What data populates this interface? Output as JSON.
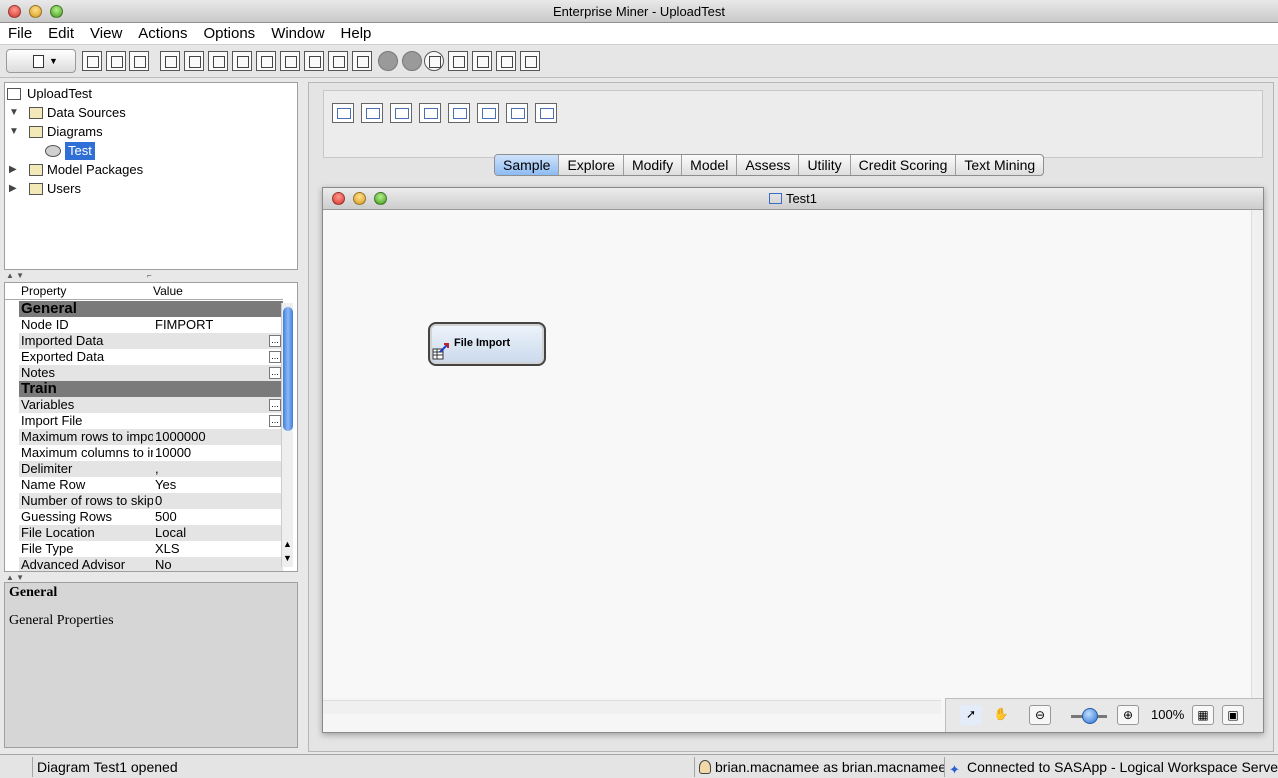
{
  "window": {
    "title": "Enterprise Miner - UploadTest"
  },
  "menu": [
    "File",
    "Edit",
    "View",
    "Actions",
    "Options",
    "Window",
    "Help"
  ],
  "tree": {
    "project": "UploadTest",
    "items": [
      {
        "label": "Data Sources",
        "expanded": true
      },
      {
        "label": "Diagrams",
        "expanded": true
      },
      {
        "label": "Test",
        "selected": true
      },
      {
        "label": "Model Packages",
        "expanded": false
      },
      {
        "label": "Users",
        "expanded": false
      }
    ]
  },
  "properties": {
    "col_property": "Property",
    "col_value": "Value",
    "rows": [
      {
        "key": "General",
        "group": true
      },
      {
        "key": "Node ID",
        "value": "FIMPORT"
      },
      {
        "key": "Imported Data",
        "value": "",
        "ellipsis": true
      },
      {
        "key": "Exported Data",
        "value": "",
        "ellipsis": true
      },
      {
        "key": "Notes",
        "value": "",
        "ellipsis": true
      },
      {
        "key": "Train",
        "group": true
      },
      {
        "key": "Variables",
        "value": "",
        "ellipsis": true
      },
      {
        "key": "Import File",
        "value": "",
        "ellipsis": true
      },
      {
        "key": "Maximum rows to import",
        "value": "1000000"
      },
      {
        "key": "Maximum columns to import",
        "value": "10000"
      },
      {
        "key": "Delimiter",
        "value": ","
      },
      {
        "key": "Name Row",
        "value": "Yes"
      },
      {
        "key": "Number of rows to skip",
        "value": "0"
      },
      {
        "key": "Guessing Rows",
        "value": "500"
      },
      {
        "key": "File Location",
        "value": "Local"
      },
      {
        "key": "File Type",
        "value": "XLS"
      },
      {
        "key": "Advanced Advisor",
        "value": "No"
      }
    ]
  },
  "description": {
    "title": "General",
    "text": "General Properties"
  },
  "tabs": [
    {
      "label": "Sample",
      "active": true
    },
    {
      "label": "Explore"
    },
    {
      "label": "Modify"
    },
    {
      "label": "Model"
    },
    {
      "label": "Assess"
    },
    {
      "label": "Utility"
    },
    {
      "label": "Credit Scoring"
    },
    {
      "label": "Text Mining"
    }
  ],
  "diagram": {
    "title": "Test1",
    "node_label": "File Import",
    "zoom": "100%"
  },
  "status": {
    "message": "Diagram Test1 opened",
    "user": "brian.macnamee as brian.macnamee",
    "connection": "Connected to SASApp - Logical Workspace Server"
  },
  "colors": {
    "selection": "#2f6fd6",
    "active_tab": "#8dbbf2"
  }
}
